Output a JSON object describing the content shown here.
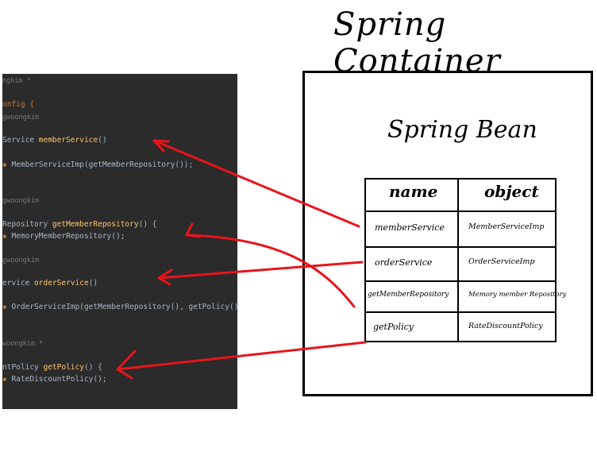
{
  "title": "Spring Container",
  "bean_title": "Spring Bean",
  "table": {
    "headers": [
      "name",
      "object"
    ],
    "rows": [
      {
        "name": "memberService",
        "object": "MemberServiceImp"
      },
      {
        "name": "orderService",
        "object": "OrderServiceImp"
      },
      {
        "name": "getMemberRepository",
        "object": "Memory member Repository"
      },
      {
        "name": "getPolicy",
        "object": "RateDiscountPolicy"
      }
    ]
  },
  "code": {
    "line1": "ngkim *",
    "line2": "onfig {",
    "line3": "gwoongkim",
    "line4a": "Service ",
    "line4b": "memberService",
    "line4c": "()",
    "line5": "MemberServiceImp(getMemberRepository());",
    "line6": "gwoongkim",
    "line7a": "Repository ",
    "line7b": "getMemberRepository",
    "line7c": "() {",
    "line8": "MemoryMemberRepository();",
    "line9": "gwoongkim",
    "line10a": "ervice ",
    "line10b": "orderService",
    "line10c": "()",
    "line11": "OrderServiceImp(getMemberRepository(), getPolicy());",
    "line12": "woongkim *",
    "line13a": "ntPolicy ",
    "line13b": "getPolicy",
    "line13c": "() {",
    "line14": "RateDiscountPolicy();"
  },
  "colors": {
    "arrow": "#e8141b",
    "code_bg": "#2b2b2b"
  }
}
